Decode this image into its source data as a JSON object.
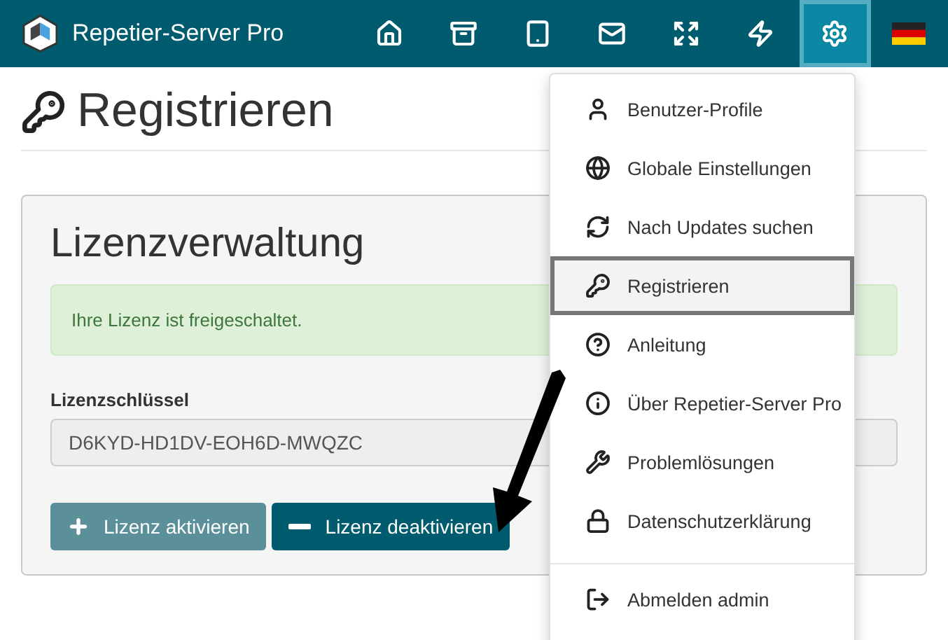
{
  "navbar": {
    "app_title": "Repetier-Server Pro",
    "items": [
      {
        "selected": false
      },
      {
        "selected": false
      },
      {
        "selected": false
      },
      {
        "selected": false
      },
      {
        "selected": false
      },
      {
        "selected": false
      },
      {
        "selected": true
      },
      {
        "selected": false
      }
    ]
  },
  "page": {
    "title": "Registrieren"
  },
  "panel": {
    "title": "Lizenzverwaltung",
    "alert": "Ihre Lizenz ist freigeschaltet.",
    "field_label": "Lizenzschlüssel",
    "field_value": "D6KYD-HD1DV-EOH6D-MWQZC",
    "buttons": [
      {
        "label": "Lizenz aktivieren",
        "kind": "activate"
      },
      {
        "label": "Lizenz deaktivieren",
        "kind": "deactivate"
      }
    ]
  },
  "menu": {
    "items": [
      {
        "label": "Benutzer-Profile",
        "selected": false
      },
      {
        "label": "Globale Einstellungen",
        "selected": false
      },
      {
        "label": "Nach Updates suchen",
        "selected": false
      },
      {
        "label": "Registrieren",
        "selected": true
      },
      {
        "label": "Anleitung",
        "selected": false
      },
      {
        "label": "Über Repetier-Server Pro",
        "selected": false
      },
      {
        "label": "Problemlösungen",
        "selected": false
      },
      {
        "label": "Datenschutzerklärung",
        "selected": false
      }
    ],
    "footer_items": [
      {
        "label": "Abmelden admin",
        "selected": false
      }
    ]
  }
}
